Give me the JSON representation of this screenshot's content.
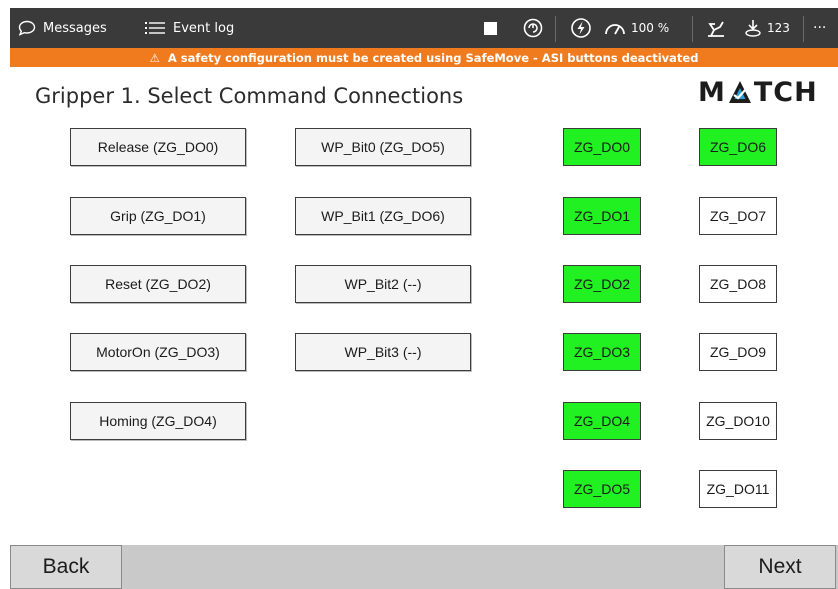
{
  "topbar": {
    "messages_label": "Messages",
    "eventlog_label": "Event log",
    "speed_label": "100 %",
    "tool_label": "123",
    "more_label": "···"
  },
  "warning": {
    "icon": "⚠",
    "text": "A safety configuration must be created using SafeMove - ASI buttons deactivated"
  },
  "page": {
    "title": "Gripper 1. Select Command Connections",
    "logo": {
      "pre": "M",
      "post": "TCH",
      "accent_color": "#2a9fd8"
    }
  },
  "commands_col1": [
    {
      "label": "Release (ZG_DO0)"
    },
    {
      "label": "Grip (ZG_DO1)"
    },
    {
      "label": "Reset (ZG_DO2)"
    },
    {
      "label": "MotorOn (ZG_DO3)"
    },
    {
      "label": "Homing (ZG_DO4)"
    }
  ],
  "commands_col2": [
    {
      "label": "WP_Bit0 (ZG_DO5)"
    },
    {
      "label": "WP_Bit1 (ZG_DO6)"
    },
    {
      "label": "WP_Bit2 (--)"
    },
    {
      "label": "WP_Bit3 (--)"
    }
  ],
  "outputs_col1": [
    {
      "label": "ZG_DO0",
      "active": true
    },
    {
      "label": "ZG_DO1",
      "active": true
    },
    {
      "label": "ZG_DO2",
      "active": true
    },
    {
      "label": "ZG_DO3",
      "active": true
    },
    {
      "label": "ZG_DO4",
      "active": true
    },
    {
      "label": "ZG_DO5",
      "active": true
    }
  ],
  "outputs_col2": [
    {
      "label": "ZG_DO6",
      "active": true
    },
    {
      "label": "ZG_DO7",
      "active": false
    },
    {
      "label": "ZG_DO8",
      "active": false
    },
    {
      "label": "ZG_DO9",
      "active": false
    },
    {
      "label": "ZG_DO10",
      "active": false
    },
    {
      "label": "ZG_DO11",
      "active": false
    }
  ],
  "colors": {
    "active": "#21f021",
    "inactive": "#ffffff"
  },
  "nav": {
    "back_label": "Back",
    "next_label": "Next"
  }
}
